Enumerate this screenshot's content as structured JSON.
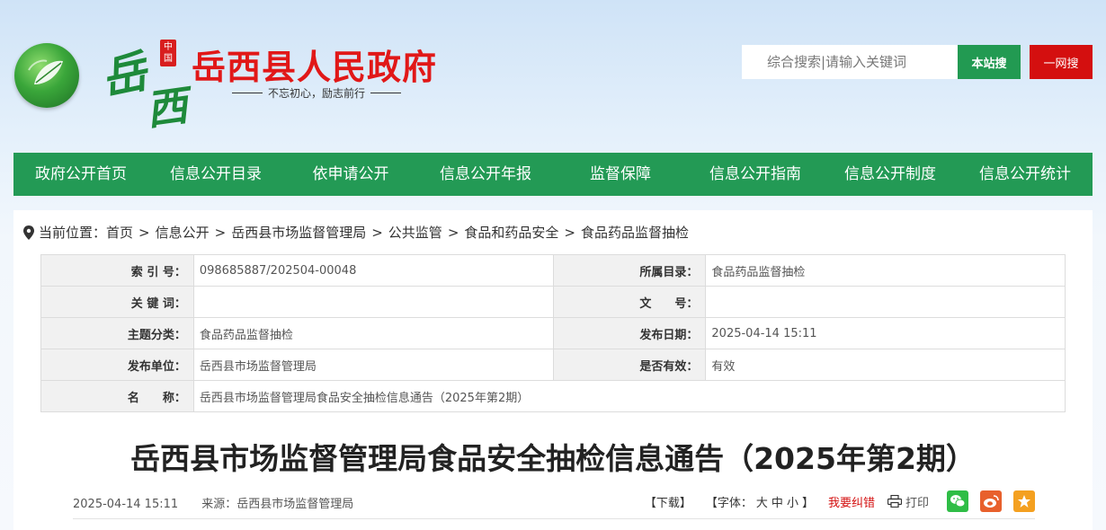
{
  "header": {
    "logo_calli_1": "岳",
    "logo_calli_2": "西",
    "seal_text": "中国",
    "site_title": "岳西县人民政府",
    "slogan": "不忘初心，励志前行",
    "search_placeholder": "综合搜索|请输入关键词",
    "btn_local": "本站搜",
    "btn_web": "一网搜"
  },
  "nav": {
    "items": [
      "政府公开首页",
      "信息公开目录",
      "依申请公开",
      "信息公开年报",
      "监督保障",
      "信息公开指南",
      "信息公开制度",
      "信息公开统计"
    ]
  },
  "breadcrumb": {
    "prefix": "当前位置：",
    "items": [
      "首页",
      "信息公开",
      "岳西县市场监督管理局",
      "公共监管",
      "食品和药品安全",
      "食品药品监督抽检"
    ],
    "sep": ">"
  },
  "meta": {
    "index_label": "索 引 号：",
    "index_value": "098685887/202504-00048",
    "dir_label": "所属目录：",
    "dir_value": "食品药品监督抽检",
    "keyword_label": "关 键 词：",
    "keyword_value": "",
    "docno_label": "文　　号：",
    "docno_value": "",
    "topic_label": "主题分类：",
    "topic_value": "食品药品监督抽检",
    "date_label": "发布日期：",
    "date_value": "2025-04-14 15:11",
    "unit_label": "发布单位：",
    "unit_value": "岳西县市场监督管理局",
    "valid_label": "是否有效：",
    "valid_value": "有效",
    "name_label": "名　　称：",
    "name_value": "岳西县市场监督管理局食品安全抽检信息通告（2025年第2期）"
  },
  "article": {
    "title": "岳西县市场监督管理局食品安全抽检信息通告（2025年第2期）",
    "date": "2025-04-14 15:11",
    "source": "来源：岳西县市场监督管理局",
    "download": "【下载】",
    "font_label": "【字体：",
    "font_large": "大",
    "font_mid": "中",
    "font_small": "小",
    "font_end": "】",
    "report_error": "我要纠错",
    "print": "打印"
  },
  "colors": {
    "nav_green": "#239a55",
    "title_red": "#e11818",
    "btn_red": "#d40f0f"
  }
}
